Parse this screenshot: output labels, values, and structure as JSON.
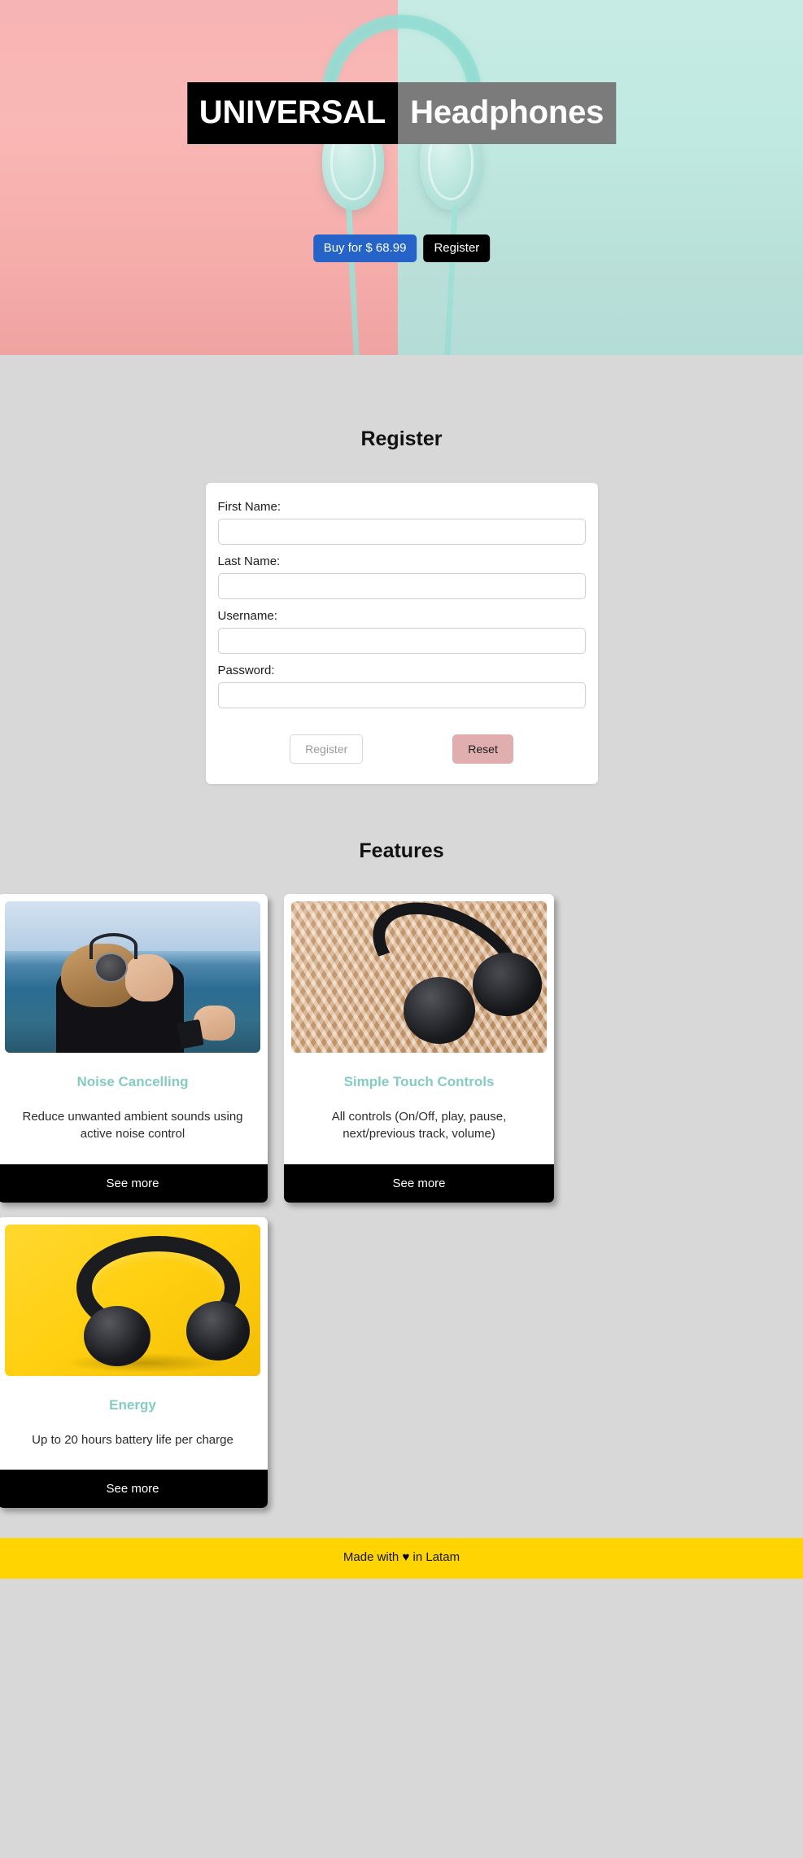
{
  "hero": {
    "title_part_dark": "UNIVERSAL",
    "title_part_gray": "Headphones",
    "buy_label": "Buy for $ 68.99",
    "register_label": "Register",
    "colors": {
      "left_bg": "#f7b4b4",
      "right_bg": "#c6ebe4",
      "buy_button": "#2563c8",
      "register_button": "#000000"
    }
  },
  "register": {
    "heading": "Register",
    "fields": [
      {
        "label": "First Name:",
        "value": "",
        "placeholder": ""
      },
      {
        "label": "Last Name:",
        "value": "",
        "placeholder": ""
      },
      {
        "label": "Username:",
        "value": "",
        "placeholder": ""
      },
      {
        "label": "Password:",
        "value": "",
        "placeholder": ""
      }
    ],
    "submit_label": "Register",
    "reset_label": "Reset",
    "colors": {
      "reset_button": "#e0aeae",
      "submit_disabled_text": "#9a9a9a"
    }
  },
  "features": {
    "heading": "Features",
    "cards": [
      {
        "title": "Noise Cancelling",
        "description": "Reduce unwanted ambient sounds using active noise control",
        "button_label": "See more",
        "image": "woman-listening-headphones-ocean-photo"
      },
      {
        "title": "Simple Touch Controls",
        "description": "All controls (On/Off, play, pause, next/previous track, volume)",
        "button_label": "See more",
        "image": "black-headphones-on-rattan-weave-photo"
      },
      {
        "title": "Energy",
        "description": "Up to 20 hours battery life per charge",
        "button_label": "See more",
        "image": "black-headphones-on-yellow-background-photo"
      }
    ],
    "colors": {
      "card_title": "#84ccc2",
      "card_button": "#000000"
    }
  },
  "footer": {
    "text_before": "Made with",
    "heart": "♥",
    "text_after": "in Latam",
    "background": "#ffd400"
  }
}
